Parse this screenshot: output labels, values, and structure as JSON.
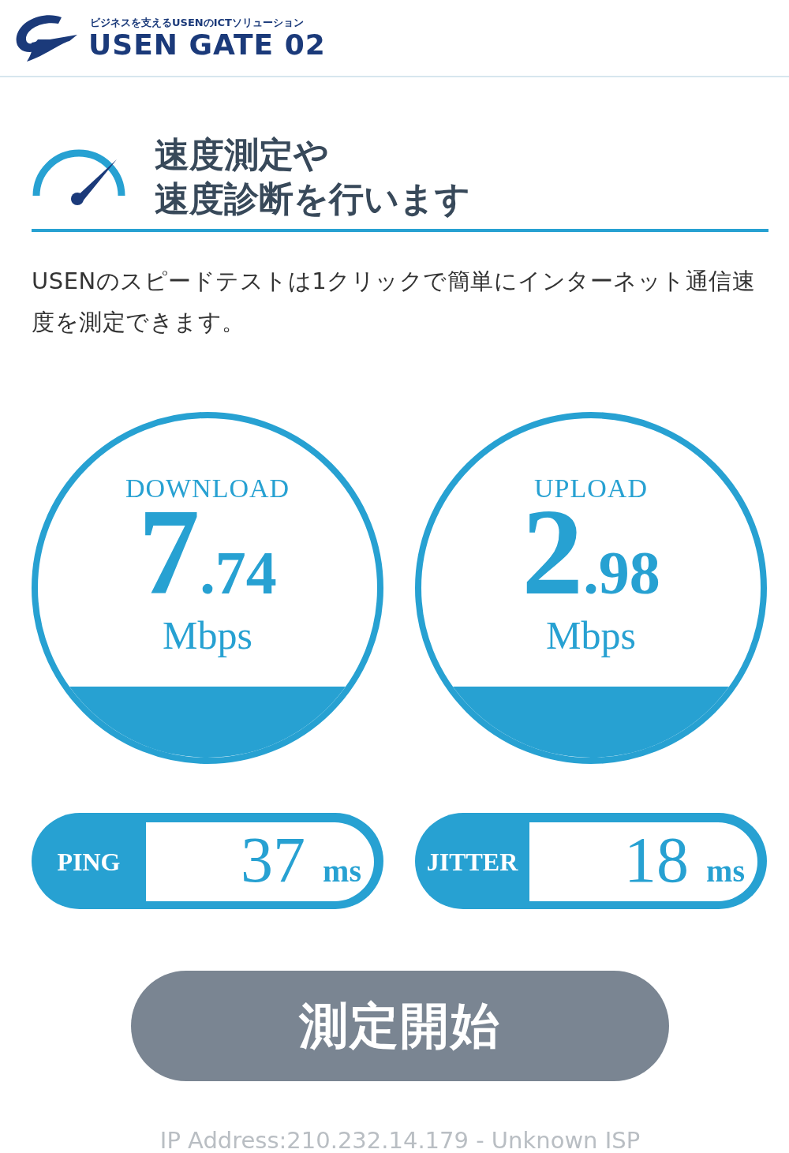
{
  "header": {
    "tagline": "ビジネスを支えるUSENのICTソリューション",
    "brand": "USEN GATE 02"
  },
  "section": {
    "title_lines": [
      "速度測定や",
      "速度診断を行います"
    ],
    "description": "USENのスピードテストは1クリックで簡単にインターネット通信速度を測定できます。"
  },
  "gauges": [
    {
      "label": "DOWNLOAD",
      "integer": "7",
      "decimal": ".74",
      "unit": "Mbps"
    },
    {
      "label": "UPLOAD",
      "integer": "2",
      "decimal": ".98",
      "unit": "Mbps"
    }
  ],
  "stats": [
    {
      "label": "PING",
      "value": "37",
      "unit": "ms"
    },
    {
      "label": "JITTER",
      "value": "18",
      "unit": "ms"
    }
  ],
  "start_button": "測定開始",
  "footer": "IP Address:210.232.14.179 - Unknown ISP"
}
